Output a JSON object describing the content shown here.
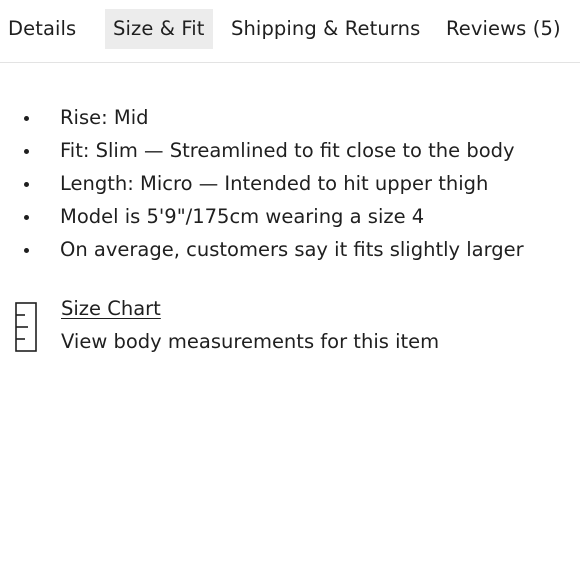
{
  "tabs": [
    {
      "label": "Details",
      "selected": false
    },
    {
      "label": "Size & Fit",
      "selected": true
    },
    {
      "label": "Shipping & Returns",
      "selected": false
    },
    {
      "label": "Reviews (5)",
      "selected": false
    }
  ],
  "fit_details": [
    "Rise: Mid",
    "Fit: Slim — Streamlined to fit close to the body",
    "Length: Micro — Intended to hit upper thigh",
    "Model is 5'9\"/175cm wearing a size 4",
    "On average, customers say it fits slightly larger"
  ],
  "size_chart": {
    "icon": "ruler-icon",
    "link_label": "Size Chart",
    "description": "View body measurements for this item"
  },
  "colors": {
    "selected_tab_bg": "#ececec",
    "text": "#1f1f1f",
    "divider": "#e3e3e3"
  }
}
